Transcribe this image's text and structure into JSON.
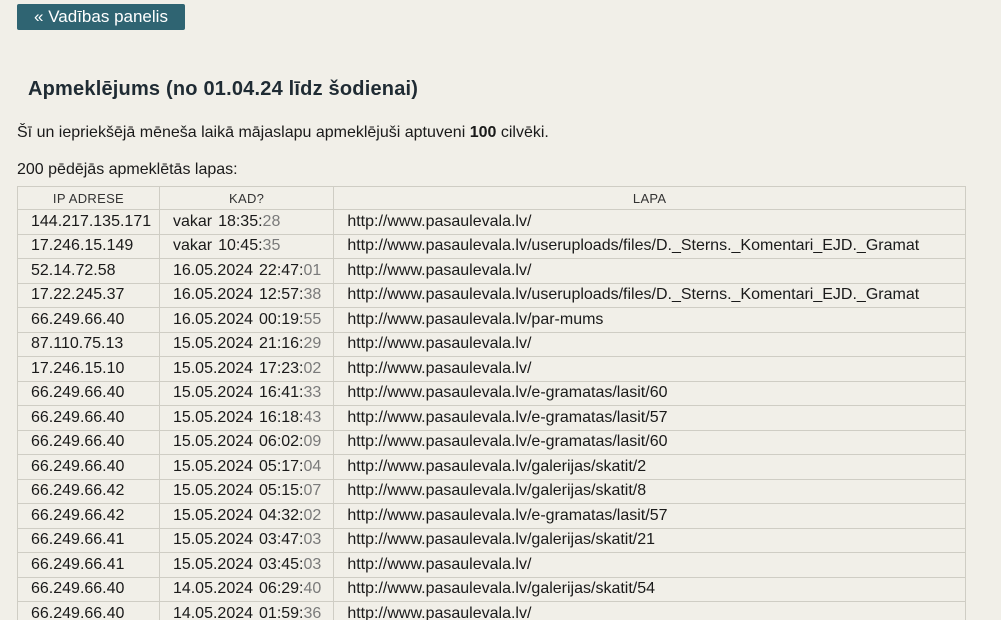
{
  "back_button": {
    "label": "« Vadības panelis"
  },
  "title": "Apmeklējums (no 01.04.24 līdz šodienai)",
  "intro": {
    "before": "Šī un iepriekšējā mēneša laikā mājaslapu apmeklējuši aptuveni ",
    "count": "100",
    "after": " cilvēki."
  },
  "list_caption": "200 pēdējās apmeklētās lapas:",
  "table": {
    "headers": {
      "ip": "IP ADRESE",
      "when": "KAD?",
      "page": "LAPA"
    },
    "rows": [
      {
        "ip": "144.217.135.171",
        "date": "vakar",
        "hm": "18:35:",
        "sec": "28",
        "url": "http://www.pasaulevala.lv/"
      },
      {
        "ip": "17.246.15.149",
        "date": "vakar",
        "hm": "10:45:",
        "sec": "35",
        "url": "http://www.pasaulevala.lv/useruploads/files/D._Sterns._Komentari_EJD._Gramat"
      },
      {
        "ip": "52.14.72.58",
        "date": "16.05.2024",
        "hm": "22:47:",
        "sec": "01",
        "url": "http://www.pasaulevala.lv/"
      },
      {
        "ip": "17.22.245.37",
        "date": "16.05.2024",
        "hm": "12:57:",
        "sec": "38",
        "url": "http://www.pasaulevala.lv/useruploads/files/D._Sterns._Komentari_EJD._Gramat"
      },
      {
        "ip": "66.249.66.40",
        "date": "16.05.2024",
        "hm": "00:19:",
        "sec": "55",
        "url": "http://www.pasaulevala.lv/par-mums"
      },
      {
        "ip": "87.110.75.13",
        "date": "15.05.2024",
        "hm": "21:16:",
        "sec": "29",
        "url": "http://www.pasaulevala.lv/"
      },
      {
        "ip": "17.246.15.10",
        "date": "15.05.2024",
        "hm": "17:23:",
        "sec": "02",
        "url": "http://www.pasaulevala.lv/"
      },
      {
        "ip": "66.249.66.40",
        "date": "15.05.2024",
        "hm": "16:41:",
        "sec": "33",
        "url": "http://www.pasaulevala.lv/e-gramatas/lasit/60"
      },
      {
        "ip": "66.249.66.40",
        "date": "15.05.2024",
        "hm": "16:18:",
        "sec": "43",
        "url": "http://www.pasaulevala.lv/e-gramatas/lasit/57"
      },
      {
        "ip": "66.249.66.40",
        "date": "15.05.2024",
        "hm": "06:02:",
        "sec": "09",
        "url": "http://www.pasaulevala.lv/e-gramatas/lasit/60"
      },
      {
        "ip": "66.249.66.40",
        "date": "15.05.2024",
        "hm": "05:17:",
        "sec": "04",
        "url": "http://www.pasaulevala.lv/galerijas/skatit/2"
      },
      {
        "ip": "66.249.66.42",
        "date": "15.05.2024",
        "hm": "05:15:",
        "sec": "07",
        "url": "http://www.pasaulevala.lv/galerijas/skatit/8"
      },
      {
        "ip": "66.249.66.42",
        "date": "15.05.2024",
        "hm": "04:32:",
        "sec": "02",
        "url": "http://www.pasaulevala.lv/e-gramatas/lasit/57"
      },
      {
        "ip": "66.249.66.41",
        "date": "15.05.2024",
        "hm": "03:47:",
        "sec": "03",
        "url": "http://www.pasaulevala.lv/galerijas/skatit/21"
      },
      {
        "ip": "66.249.66.41",
        "date": "15.05.2024",
        "hm": "03:45:",
        "sec": "03",
        "url": "http://www.pasaulevala.lv/"
      },
      {
        "ip": "66.249.66.40",
        "date": "14.05.2024",
        "hm": "06:29:",
        "sec": "40",
        "url": "http://www.pasaulevala.lv/galerijas/skatit/54"
      },
      {
        "ip": "66.249.66.40",
        "date": "14.05.2024",
        "hm": "01:59:",
        "sec": "36",
        "url": "http://www.pasaulevala.lv/"
      }
    ]
  }
}
